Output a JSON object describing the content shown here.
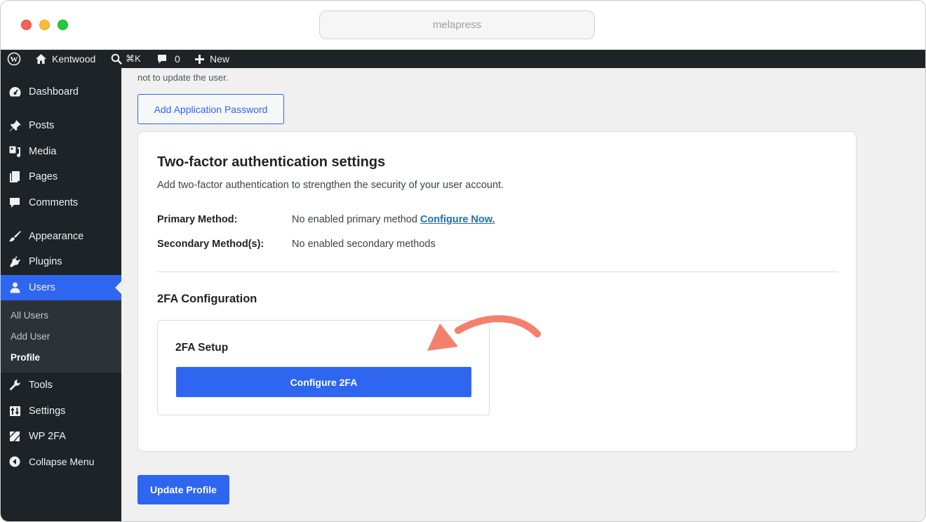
{
  "browser": {
    "url": "melapress"
  },
  "adminbar": {
    "site_name": "Kentwood",
    "search_shortcut": "⌘K",
    "comment_count": "0",
    "new_label": "New"
  },
  "sidebar": {
    "items": [
      {
        "label": "Dashboard",
        "icon": "dashboard-icon"
      },
      {
        "label": "Posts",
        "icon": "pin-icon"
      },
      {
        "label": "Media",
        "icon": "media-icon"
      },
      {
        "label": "Pages",
        "icon": "pages-icon"
      },
      {
        "label": "Comments",
        "icon": "comment-icon"
      },
      {
        "label": "Appearance",
        "icon": "brush-icon"
      },
      {
        "label": "Plugins",
        "icon": "plugin-icon"
      },
      {
        "label": "Users",
        "icon": "user-icon"
      },
      {
        "label": "Tools",
        "icon": "wrench-icon"
      },
      {
        "label": "Settings",
        "icon": "settings-icon"
      },
      {
        "label": "WP 2FA",
        "icon": "shield-check-icon"
      },
      {
        "label": "Collapse Menu",
        "icon": "collapse-icon"
      }
    ],
    "users_submenu": [
      "All Users",
      "Add User",
      "Profile"
    ]
  },
  "main": {
    "note": "not to update the user.",
    "add_app_password": "Add Application Password",
    "tfa": {
      "title": "Two-factor authentication settings",
      "description": "Add two-factor authentication to strengthen the security of your user account.",
      "primary_label": "Primary Method:",
      "primary_value": "No enabled primary method",
      "configure_now": "Configure Now.",
      "secondary_label": "Secondary Method(s):",
      "secondary_value": "No enabled secondary methods",
      "config_heading": "2FA Configuration",
      "setup_heading": "2FA Setup",
      "configure_button": "Configure 2FA"
    },
    "update_button": "Update Profile"
  },
  "colors": {
    "accent": "#2e66f0",
    "adminbar": "#1d2327",
    "arrow": "#f4806b"
  }
}
